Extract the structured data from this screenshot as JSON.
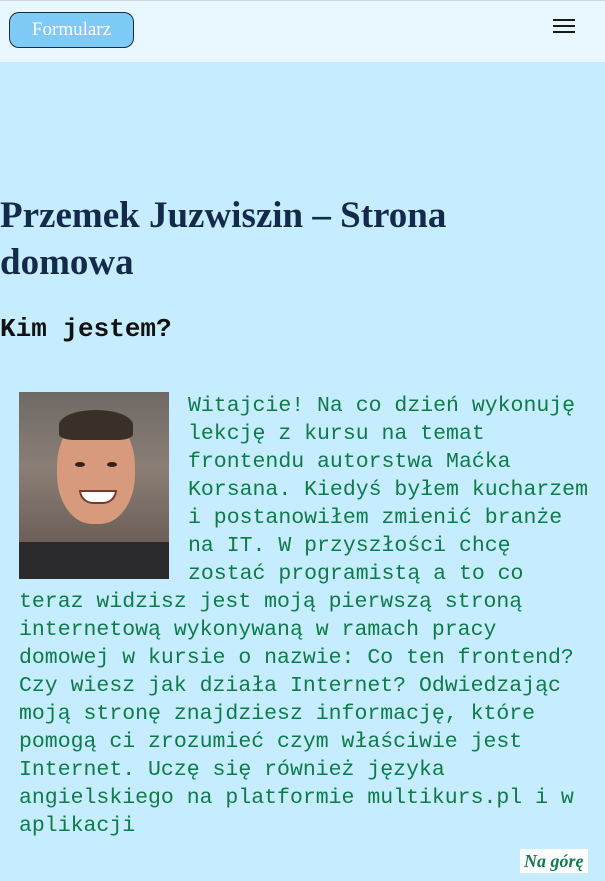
{
  "nav": {
    "form_button_label": "Formularz",
    "menu_icon": "hamburger-menu-icon"
  },
  "page": {
    "title": "Przemek Juzwiszin – Strona domowa",
    "section_heading": "Kim jestem?",
    "photo_icon": "profile-photo",
    "intro_text": "Witajcie! Na co dzień wykonuję lekcję z kursu na temat frontendu autorstwa Maćka Korsana. Kiedyś byłem kucharzem i postanowiłem zmienić branże na IT. W przyszłości chcę zostać programistą a to co teraz widzisz jest moją pierwszą stroną internetową wykonywaną w ramach pracy domowej w kursie o nazwie: Co ten frontend? Czy wiesz jak działa Internet? Odwiedzając moją stronę znajdziesz informację, które pomogą ci zrozumieć czym właściwie jest Internet. Uczę się również języka angielskiego na platformie multikurs.pl i w aplikacji"
  },
  "footer": {
    "to_top_label": "Na górę"
  },
  "colors": {
    "page_background": "#c6ecff",
    "topbar_background": "#e9f7ff",
    "button_background": "#7fcbf7",
    "title_color": "#142a4a",
    "body_text_color": "#0f7a4a"
  }
}
